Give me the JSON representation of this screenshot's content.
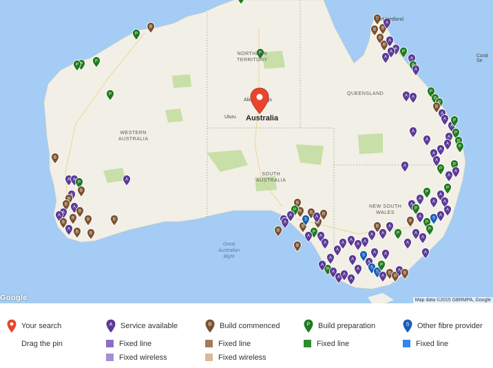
{
  "colors": {
    "water": "#a4ccf4",
    "land": "#f2efe6",
    "park": "#c8dfa8",
    "your_search": "#e8452c",
    "service_available": "#5b3a96",
    "build_commenced": "#7a5230",
    "build_preparation": "#1f7a1f",
    "other_fibre": "#1a5fb4",
    "fixed_line_service": "#8d6fc4",
    "fixed_wireless_service": "#a78ecf",
    "fixed_line_build": "#a27a5c",
    "fixed_wireless_build": "#dcb896",
    "fixed_line_prep": "#2e8b2e",
    "fixed_line_other": "#2f86f0"
  },
  "map": {
    "place_label": "Australia",
    "regions": [
      "NORTHERN\nTERRITORY",
      "QUEENSLAND",
      "WESTERN\nAUSTRALIA",
      "SOUTH\nAUSTRALIA",
      "NEW SOUTH\nWALES"
    ],
    "cities": [
      "Uluru",
      "Alice Springs",
      "Port Hedland",
      "Coral Se"
    ],
    "sea_label": "Great\nAustralian\nBight",
    "attribution": "Map data ©2015 GBRMPA, Google",
    "logo": "Google",
    "pin_letters": {
      "service_available": "A",
      "build_commenced": "B",
      "build_preparation": "P",
      "other_fibre": "S"
    }
  },
  "legend": {
    "your_search": {
      "title": "Your search",
      "note": "Drag the pin",
      "icon": "map-pin-icon"
    },
    "service_available": {
      "title": "Service available",
      "fixed_line": "Fixed line",
      "fixed_wireless": "Fixed wireless",
      "icon": "map-pin-icon"
    },
    "build_commenced": {
      "title": "Build commenced",
      "fixed_line": "Fixed line",
      "fixed_wireless": "Fixed wireless",
      "icon": "map-pin-icon"
    },
    "build_preparation": {
      "title": "Build preparation",
      "fixed_line": "Fixed line",
      "icon": "map-pin-icon"
    },
    "other_fibre": {
      "title": "Other fibre provider",
      "fixed_line": "Fixed line",
      "icon": "map-pin-icon"
    }
  }
}
